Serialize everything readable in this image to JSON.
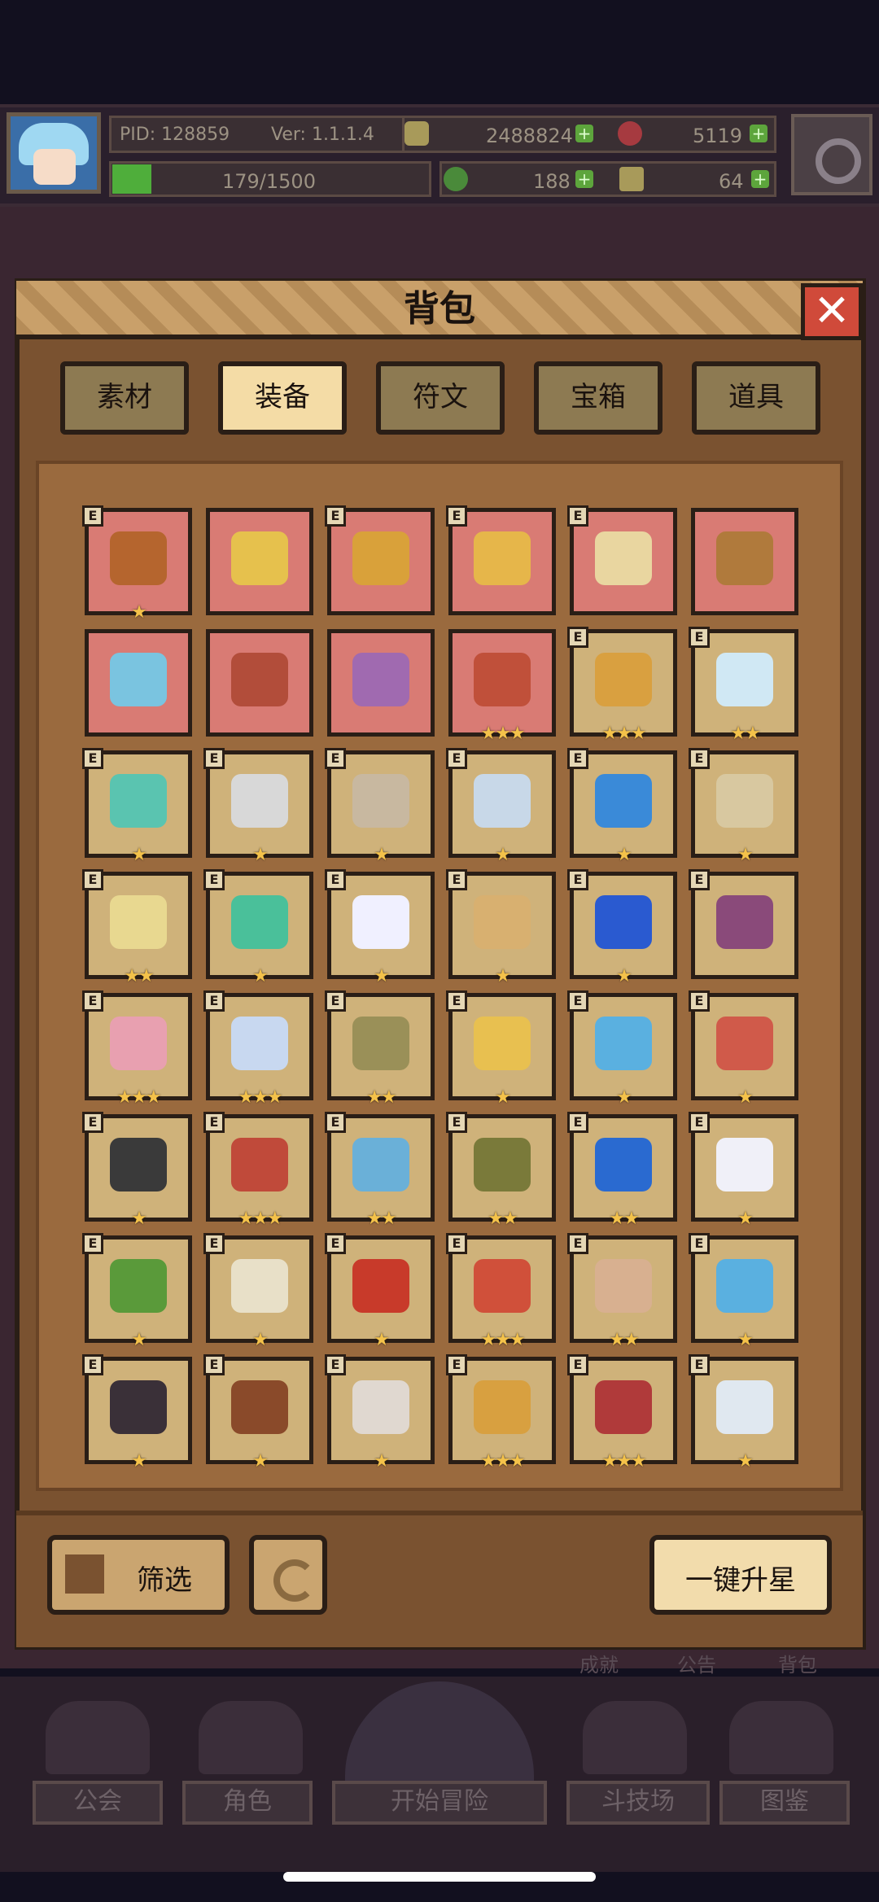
{
  "hud": {
    "pid": "PID: 128859",
    "version": "Ver: 1.1.1.4",
    "gold": "2488824",
    "gems": "5119",
    "exp": "179/1500",
    "clover": "188",
    "energy": "64",
    "plus": "+"
  },
  "panel": {
    "title": "背包",
    "close": "✕"
  },
  "tabs": [
    "素材",
    "装备",
    "符文",
    "宝箱",
    "道具"
  ],
  "active_tab": "装备",
  "grid": {
    "rows": [
      [
        {
          "bg": "red",
          "stars": 1,
          "icon": "staff",
          "color": "#b5652e",
          "tag": "E"
        },
        {
          "bg": "red",
          "stars": 0,
          "icon": "straw-hat",
          "color": "#e6c14d",
          "tag": ""
        },
        {
          "bg": "red",
          "stars": 0,
          "icon": "horned-helm",
          "color": "#d9a13a",
          "tag": "E"
        },
        {
          "bg": "red",
          "stars": 0,
          "icon": "amulet",
          "color": "#e6b64a",
          "tag": "E"
        },
        {
          "bg": "red",
          "stars": 0,
          "icon": "ring",
          "color": "#e9d6a0",
          "tag": "E"
        },
        {
          "bg": "red",
          "stars": 0,
          "icon": "crown",
          "color": "#b07a3c",
          "tag": ""
        }
      ],
      [
        {
          "bg": "red",
          "stars": 0,
          "icon": "helmet",
          "color": "#7ac4e0",
          "tag": ""
        },
        {
          "bg": "red",
          "stars": 0,
          "icon": "robe",
          "color": "#b24d3a",
          "tag": ""
        },
        {
          "bg": "red",
          "stars": 0,
          "icon": "chain-vest",
          "color": "#a06ab0",
          "tag": ""
        },
        {
          "bg": "red",
          "stars": 3,
          "icon": "pot",
          "color": "#c0503a",
          "tag": ""
        },
        {
          "bg": "gold",
          "stars": 3,
          "icon": "mace",
          "color": "#d9a040",
          "tag": "E"
        },
        {
          "bg": "gold",
          "stars": 2,
          "icon": "wand",
          "color": "#d0e8f4",
          "tag": "E"
        }
      ],
      [
        {
          "bg": "gold",
          "stars": 1,
          "icon": "bow",
          "color": "#5ac4b0",
          "tag": "E"
        },
        {
          "bg": "gold",
          "stars": 1,
          "icon": "axe",
          "color": "#d8d8d8",
          "tag": "E"
        },
        {
          "bg": "gold",
          "stars": 1,
          "icon": "battle-axe",
          "color": "#c8b8a0",
          "tag": "E"
        },
        {
          "bg": "gold",
          "stars": 1,
          "icon": "sword",
          "color": "#c8d8e8",
          "tag": "E"
        },
        {
          "bg": "gold",
          "stars": 1,
          "icon": "sapphire-staff",
          "color": "#3a8ad8",
          "tag": "E"
        },
        {
          "bg": "gold",
          "stars": 1,
          "icon": "crossbow",
          "color": "#d8c8a0",
          "tag": "E"
        }
      ],
      [
        {
          "bg": "gold",
          "stars": 2,
          "icon": "golden-arrow",
          "color": "#e8d890",
          "tag": "E"
        },
        {
          "bg": "gold",
          "stars": 1,
          "icon": "green-arrow",
          "color": "#4ac09a",
          "tag": "E"
        },
        {
          "bg": "gold",
          "stars": 1,
          "icon": "orb",
          "color": "#f0f0ff",
          "tag": "E"
        },
        {
          "bg": "gold",
          "stars": 1,
          "icon": "shield",
          "color": "#d8b070",
          "tag": "E"
        },
        {
          "bg": "gold",
          "stars": 1,
          "icon": "blue-gem",
          "color": "#2a5ad0",
          "tag": "E"
        },
        {
          "bg": "gold",
          "stars": 0,
          "icon": "round-shield",
          "color": "#8a4a7a",
          "tag": "E"
        }
      ],
      [
        {
          "bg": "gold",
          "stars": 3,
          "icon": "bear-hat",
          "color": "#e8a0b0",
          "tag": "E"
        },
        {
          "bg": "gold",
          "stars": 3,
          "icon": "crystal-crown",
          "color": "#c8d8f0",
          "tag": "E"
        },
        {
          "bg": "gold",
          "stars": 2,
          "icon": "knight-helm",
          "color": "#9a9058",
          "tag": "E"
        },
        {
          "bg": "gold",
          "stars": 1,
          "icon": "halo",
          "color": "#e8c050",
          "tag": "E"
        },
        {
          "bg": "gold",
          "stars": 1,
          "icon": "blue-hat",
          "color": "#5ab0e0",
          "tag": "E"
        },
        {
          "bg": "gold",
          "stars": 1,
          "icon": "ruby-necklace",
          "color": "#d05a4a",
          "tag": "E"
        }
      ],
      [
        {
          "bg": "gold",
          "stars": 1,
          "icon": "dark-armor",
          "color": "#3a3a3a",
          "tag": "E"
        },
        {
          "bg": "gold",
          "stars": 3,
          "icon": "red-coat",
          "color": "#c04a3a",
          "tag": "E"
        },
        {
          "bg": "gold",
          "stars": 2,
          "icon": "blue-armor",
          "color": "#6ab0d8",
          "tag": "E"
        },
        {
          "bg": "gold",
          "stars": 2,
          "icon": "olive-armor",
          "color": "#7a7a3a",
          "tag": "E"
        },
        {
          "bg": "gold",
          "stars": 2,
          "icon": "blue-cape",
          "color": "#2a6ad0",
          "tag": "E"
        },
        {
          "bg": "gold",
          "stars": 1,
          "icon": "wings",
          "color": "#f0f0f8",
          "tag": "E"
        }
      ],
      [
        {
          "bg": "gold",
          "stars": 1,
          "icon": "green-cloak",
          "color": "#5a9a3a",
          "tag": "E"
        },
        {
          "bg": "gold",
          "stars": 1,
          "icon": "angel-armor",
          "color": "#e8e0c8",
          "tag": "E"
        },
        {
          "bg": "gold",
          "stars": 1,
          "icon": "fire-armor",
          "color": "#c83a2a",
          "tag": "E"
        },
        {
          "bg": "gold",
          "stars": 3,
          "icon": "red-glove",
          "color": "#d0503a",
          "tag": "E"
        },
        {
          "bg": "gold",
          "stars": 2,
          "icon": "spiked-ring",
          "color": "#d8b090",
          "tag": "E"
        },
        {
          "bg": "gold",
          "stars": 1,
          "icon": "ice-boot",
          "color": "#5ab0e0",
          "tag": "E"
        }
      ],
      [
        {
          "bg": "gold",
          "stars": 1,
          "icon": "dark-glove",
          "color": "#3a3038",
          "tag": "E"
        },
        {
          "bg": "gold",
          "stars": 1,
          "icon": "bracer",
          "color": "#8a4a2a",
          "tag": "E"
        },
        {
          "bg": "gold",
          "stars": 1,
          "icon": "angel-gauntlet",
          "color": "#e0d8d0",
          "tag": "E"
        },
        {
          "bg": "gold",
          "stars": 3,
          "icon": "gold-ring",
          "color": "#d8a040",
          "tag": "E"
        },
        {
          "bg": "gold",
          "stars": 3,
          "icon": "jewel-belt",
          "color": "#b03a3a",
          "tag": "E"
        },
        {
          "bg": "gold",
          "stars": 1,
          "icon": "white-belt",
          "color": "#e0e8f0",
          "tag": "E"
        }
      ]
    ]
  },
  "bottom": {
    "filter": "筛选",
    "auto_star": "一键升星"
  },
  "nav": {
    "guild": "公会",
    "character": "角色",
    "adventure": "开始冒险",
    "arena": "斗技场",
    "codex": "图鉴",
    "behind_1": "成就",
    "behind_2": "公告",
    "behind_3": "背包"
  }
}
